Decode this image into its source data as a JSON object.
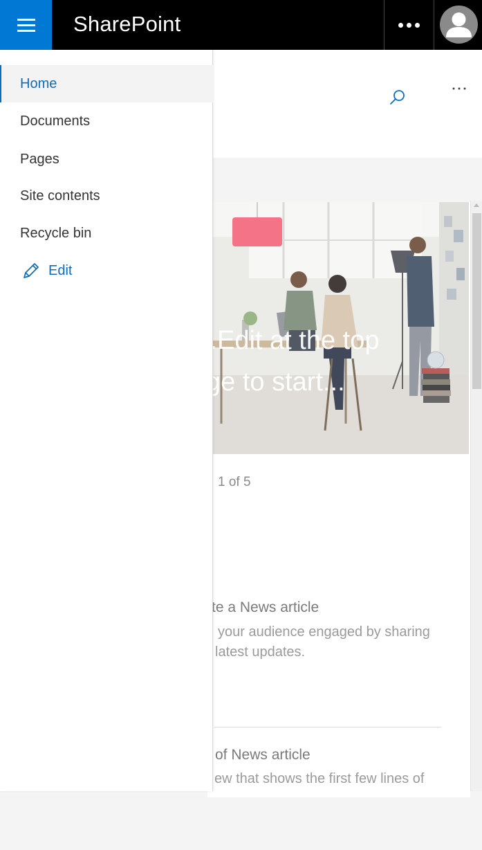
{
  "suite": {
    "app_title": "SharePoint",
    "menu_icon": "hamburger-menu-icon",
    "more_icon": "more-horizontal-icon",
    "avatar_icon": "person-icon",
    "bar_color": "#000000",
    "accent": "#0078d4"
  },
  "nav": {
    "items": [
      {
        "label": "Home",
        "active": true
      },
      {
        "label": "Documents"
      },
      {
        "label": "Pages"
      },
      {
        "label": "Site contents"
      },
      {
        "label": "Recycle bin"
      }
    ],
    "edit_label": "Edit",
    "edit_icon": "pencil-icon",
    "active_color": "#0f6cbd"
  },
  "page": {
    "search_icon": "search-icon",
    "more_icon": "ellipsis-icon",
    "hero": {
      "line1": "Edit at the top",
      "line2": "ge to start..."
    },
    "pager": "1 of 5",
    "news": [
      {
        "title": "te a News article",
        "desc_line1": "your audience engaged by sharing",
        "desc_line2": "latest updates."
      },
      {
        "title": "of News article",
        "desc_line1": "ew that shows the first few lines of"
      }
    ]
  }
}
